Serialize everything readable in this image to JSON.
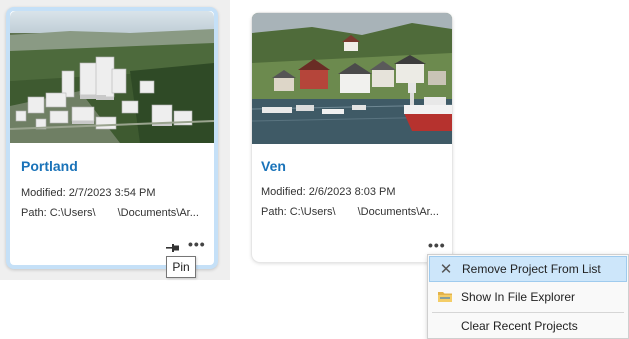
{
  "projects": [
    {
      "title": "Portland",
      "modified": "Modified: 2/7/2023 3:54 PM",
      "path_prefix": "Path: C:\\Users\\",
      "path_suffix": "\\Documents\\Ar...",
      "thumbnail": "3d-city-scene",
      "pin_icon": "pin-icon",
      "more_icon": "more-options-icon",
      "highlight_color": "#c5e0f7"
    },
    {
      "title": "Ven",
      "modified": "Modified: 2/6/2023 8:03 PM",
      "path_prefix": "Path: C:\\Users\\",
      "path_suffix": "\\Documents\\Ar...",
      "thumbnail": "harbor-village-photo",
      "more_icon": "more-options-icon"
    }
  ],
  "tooltip": {
    "text": "Pin"
  },
  "context_menu": {
    "items": [
      {
        "label": "Remove Project From List",
        "icon": "close-icon",
        "highlighted": true
      },
      {
        "label": "Show In File Explorer",
        "icon": "folder-icon"
      },
      {
        "label": "Clear Recent Projects",
        "icon": ""
      }
    ]
  },
  "colors": {
    "title_link": "#1a73b9",
    "menu_highlight": "#cde6fa",
    "card_selected_border": "#c5e0f7"
  }
}
